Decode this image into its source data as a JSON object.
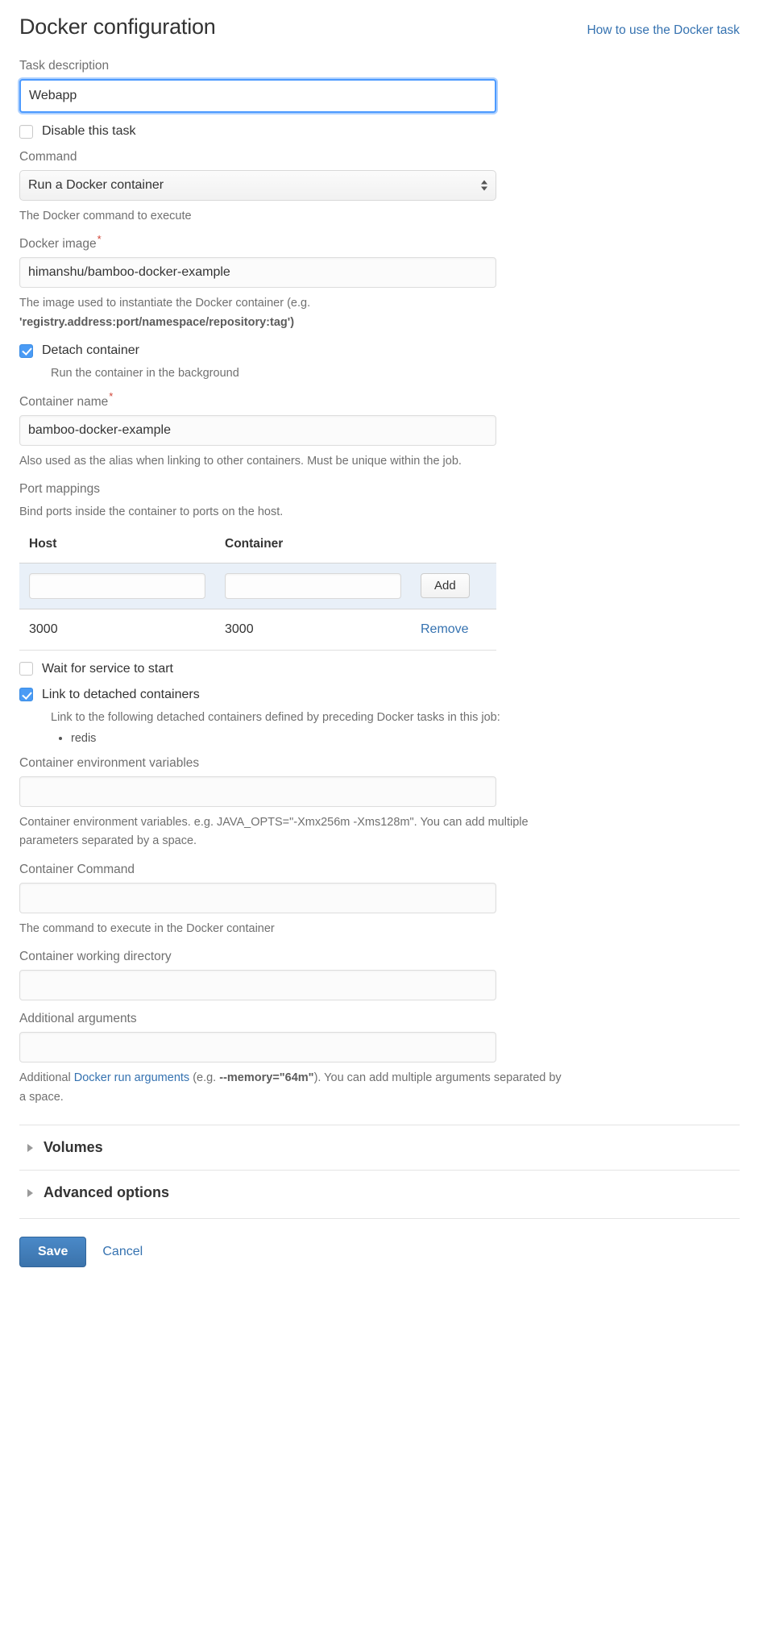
{
  "header": {
    "title": "Docker configuration",
    "help_link": "How to use the Docker task"
  },
  "fields": {
    "task_description": {
      "label": "Task description",
      "value": "Webapp"
    },
    "disable_task": {
      "label": "Disable this task",
      "checked": false
    },
    "command": {
      "label": "Command",
      "value": "Run a Docker container",
      "help": "The Docker command to execute"
    },
    "docker_image": {
      "label": "Docker image",
      "required_marker": "*",
      "value": "himanshu/bamboo-docker-example",
      "help_part1": "The image used to instantiate the Docker container (e.g. ",
      "help_strong": "'registry.address:port/namespace/repository:tag')"
    },
    "detach_container": {
      "label": "Detach container",
      "checked": true,
      "sub_help": "Run the container in the background"
    },
    "container_name": {
      "label": "Container name",
      "required_marker": "*",
      "value": "bamboo-docker-example",
      "help": "Also used as the alias when linking to other containers. Must be unique within the job."
    },
    "port_mappings": {
      "label": "Port mappings",
      "help": "Bind ports inside the container to ports on the host.",
      "columns": [
        "Host",
        "Container"
      ],
      "add_label": "Add",
      "new_host_value": "",
      "new_container_value": "",
      "rows": [
        {
          "host": "3000",
          "container": "3000",
          "action": "Remove"
        }
      ]
    },
    "wait_for_service": {
      "label": "Wait for service to start",
      "checked": false
    },
    "link_detached": {
      "label": "Link to detached containers",
      "checked": true,
      "sub_help": "Link to the following detached containers defined by preceding Docker tasks in this job:",
      "containers": [
        "redis"
      ]
    },
    "env_variables": {
      "label": "Container environment variables",
      "value": "",
      "help": "Container environment variables. e.g. JAVA_OPTS=\"-Xmx256m -Xms128m\". You can add multiple parameters separated by a space."
    },
    "container_command": {
      "label": "Container Command",
      "value": "",
      "help": "The command to execute in the Docker container"
    },
    "working_directory": {
      "label": "Container working directory",
      "value": ""
    },
    "additional_arguments": {
      "label": "Additional arguments",
      "value": "",
      "help_part1": "Additional ",
      "help_link": "Docker run arguments",
      "help_part2": " (e.g. ",
      "help_strong": "--memory=\"64m\"",
      "help_part3": "). You can add multiple arguments separated by a space."
    }
  },
  "sections": [
    {
      "title": "Volumes"
    },
    {
      "title": "Advanced options"
    }
  ],
  "footer": {
    "save_label": "Save",
    "cancel_label": "Cancel"
  },
  "colors": {
    "link": "#3572b0",
    "accent_checkbox": "#4a9bf5",
    "required": "#d04437",
    "table_row_bg": "#e9f0f8",
    "save_button": "#3b73ab"
  }
}
